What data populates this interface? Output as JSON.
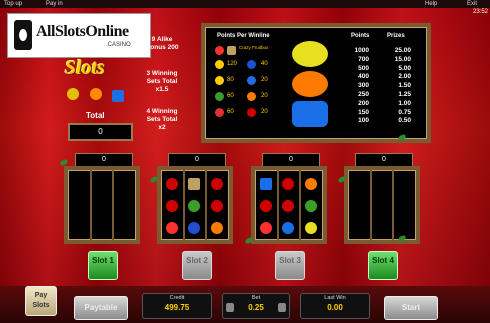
{
  "topbar": {
    "top_up": "Top up",
    "pay_in": "Pay in",
    "help": "Help",
    "exit": "Exit",
    "clock": "23:52"
  },
  "logo": {
    "name": "AllSlotsOnline",
    "sub": ".CASINO"
  },
  "game_logo": "Slots",
  "info_left": {
    "line1": "9 Alike",
    "line2": "Bonus 200",
    "line3": "3 Winning",
    "line4": "Sets Total",
    "line5": "x1.5",
    "line6": "4 Winning",
    "line7": "Sets Total",
    "line8": "x2"
  },
  "total": {
    "label": "Total",
    "value": "0"
  },
  "paytable": {
    "points_header": "Points Per Winline",
    "points_col": "Points",
    "prizes_col": "Prizes",
    "rows": [
      {
        "a": "Crazy Fruitbox",
        "b": ""
      },
      {
        "a": "120",
        "b": "40"
      },
      {
        "a": "80",
        "b": "20"
      },
      {
        "a": "60",
        "b": "20"
      },
      {
        "a": "60",
        "b": "20"
      }
    ],
    "points": [
      "1000",
      "700",
      "500",
      "400",
      "300",
      "250",
      "200",
      "150",
      "100"
    ],
    "prizes": [
      "25.00",
      "15.00",
      "5.00",
      "2.00",
      "1.50",
      "1.25",
      "1.00",
      "0.75",
      "0.50"
    ]
  },
  "slots": [
    {
      "counter": "0",
      "label": "Slot 1",
      "active": true
    },
    {
      "counter": "0",
      "label": "Slot 2",
      "active": false
    },
    {
      "counter": "0",
      "label": "Slot 3",
      "active": false
    },
    {
      "counter": "0",
      "label": "Slot 4",
      "active": true
    }
  ],
  "bottom": {
    "pay_slots": "Pay Slots",
    "paytable": "Paytable",
    "credit_label": "Credit",
    "credit_value": "499.75",
    "bet_label": "Bet",
    "bet_value": "0.25",
    "last_win_label": "Last Win",
    "last_win_value": "0.00",
    "start": "Start"
  },
  "colors": {
    "frame": "#7a5a30",
    "gold": "#ffd200",
    "green_button": "#1d8a1d"
  }
}
